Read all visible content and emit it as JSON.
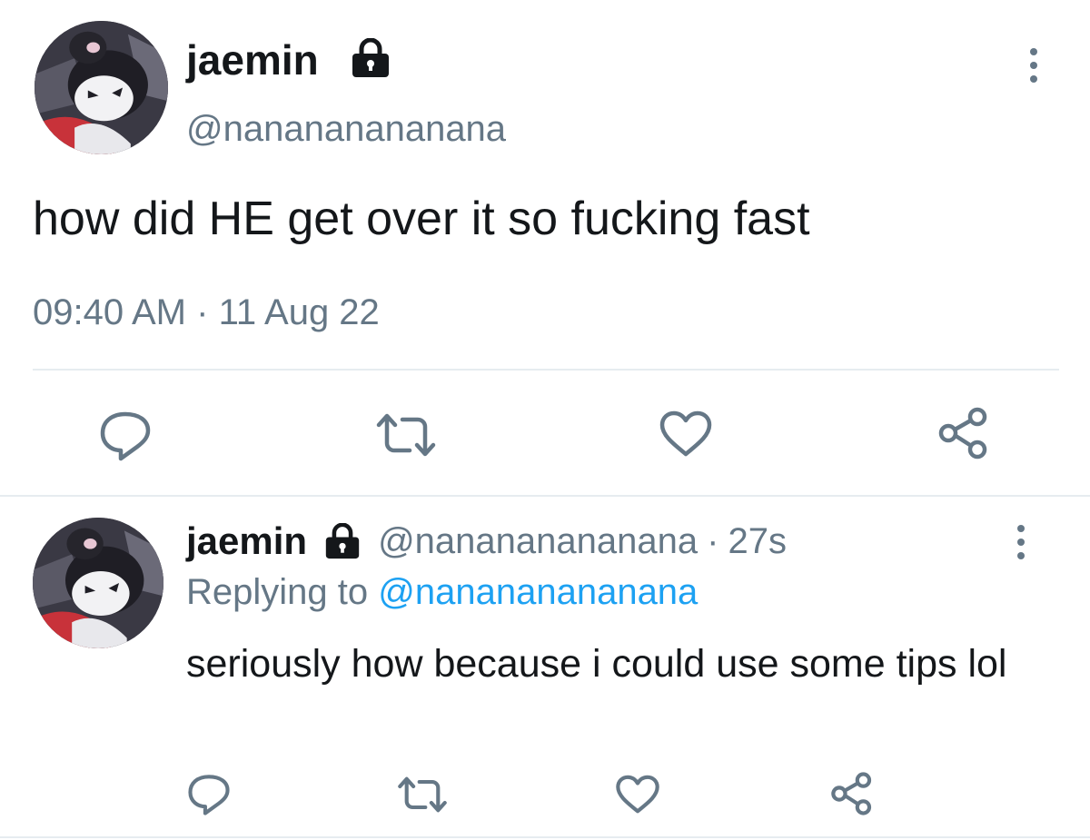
{
  "main_tweet": {
    "display_name": "jaemin",
    "handle": "@nanananananana",
    "text": "how did HE get over it so fucking fast",
    "time": "09:40 AM",
    "separator": "·",
    "date": "11 Aug 22",
    "icons": {
      "lock": "lock-icon",
      "more": "more-vertical-icon",
      "reply": "reply-icon",
      "retweet": "retweet-icon",
      "like": "heart-icon",
      "share": "share-icon"
    }
  },
  "reply_tweet": {
    "display_name": "jaemin",
    "handle": "@nanananananana",
    "separator": "·",
    "age": "27s",
    "replying_to_label": "Replying to",
    "replying_to_handle": "@nanananananana",
    "text": "seriously how because i could use some tips lol"
  },
  "colors": {
    "text": "#14171a",
    "secondary": "#657786",
    "link": "#1da1f2",
    "divider": "#e6ecf0"
  }
}
